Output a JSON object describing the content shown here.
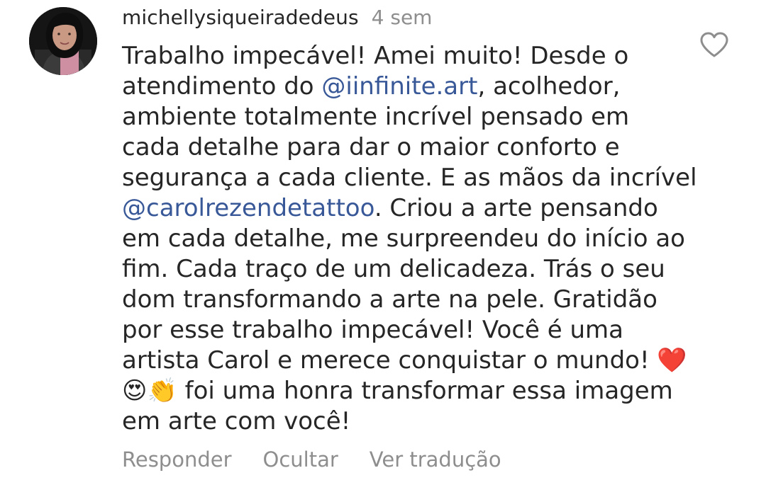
{
  "comment": {
    "username": "michellysiqueiradedeus",
    "timestamp": "4 sem",
    "body_lines": [
      [
        {
          "t": "Trabalho impecável! Amei muito! Desde o"
        }
      ],
      [
        {
          "t": "atendimento do "
        },
        {
          "t": "@iinfinite.art",
          "mention": true
        },
        {
          "t": ",  acolhedor,"
        }
      ],
      [
        {
          "t": "ambiente totalmente incrível pensado em"
        }
      ],
      [
        {
          "t": "cada detalhe para dar o maior conforto e"
        }
      ],
      [
        {
          "t": "segurança a cada cliente. E as mãos da incrível"
        }
      ],
      [
        {
          "t": "@carolrezendetattoo",
          "mention": true
        },
        {
          "t": ". Criou a arte pensando"
        }
      ],
      [
        {
          "t": "em cada detalhe, me surpreendeu do início ao"
        }
      ],
      [
        {
          "t": "fim. Cada traço de um delicadeza. Trás o seu"
        }
      ],
      [
        {
          "t": "dom transformando a arte na pele. Gratidão"
        }
      ],
      [
        {
          "t": "por esse trabalho impecável! Você é uma"
        }
      ],
      [
        {
          "t": "artista Carol e merece conquistar o mundo! "
        },
        {
          "t": "❤️",
          "emoji": "red-heart"
        }
      ],
      [
        {
          "t": "😍",
          "emoji": "heart-eyes"
        },
        {
          "t": "👏",
          "emoji": "clapping-hands"
        },
        {
          "t": " foi uma honra transformar essa imagem"
        }
      ],
      [
        {
          "t": "em arte com você!"
        }
      ]
    ]
  },
  "actions": {
    "reply": "Responder",
    "hide": "Ocultar",
    "translate": "Ver tradução"
  },
  "icons": {
    "like": "heart-outline-icon",
    "avatar": "profile-photo"
  },
  "colors": {
    "text": "#262626",
    "secondary": "#8e8e8e",
    "mention": "#385898"
  }
}
